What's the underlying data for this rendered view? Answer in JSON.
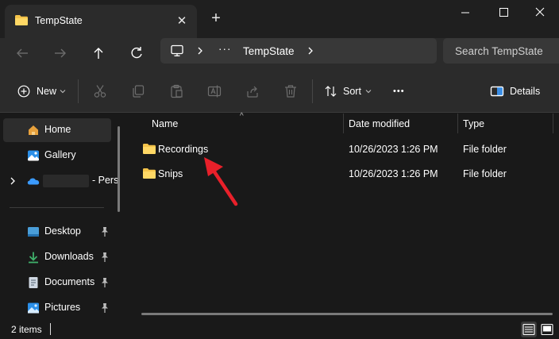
{
  "window": {
    "tab_title": "TempState",
    "tab_close_glyph": "✕",
    "new_tab_glyph": "+",
    "controls": [
      "minimize-icon",
      "maximize-icon",
      "close-icon"
    ]
  },
  "address": {
    "more_glyph": "···",
    "crumbs": [
      "TempState"
    ],
    "search_placeholder": "Search TempState"
  },
  "toolbar": {
    "new_label": "New",
    "sort_label": "Sort",
    "more_glyph": "•••",
    "details_label": "Details",
    "icons": [
      "cut-icon",
      "copy-icon",
      "paste-icon",
      "rename-icon",
      "share-icon",
      "delete-icon"
    ]
  },
  "sidebar": {
    "items": [
      {
        "label": "Home",
        "icon": "home-icon",
        "pinned": false
      },
      {
        "label": "Gallery",
        "icon": "gallery-icon",
        "pinned": false
      },
      {
        "label": "- Pers",
        "icon": "onedrive-icon",
        "pinned": false
      },
      {
        "label": "Desktop",
        "icon": "desktop-icon",
        "pinned": true
      },
      {
        "label": "Downloads",
        "icon": "downloads-icon",
        "pinned": true
      },
      {
        "label": "Documents",
        "icon": "documents-icon",
        "pinned": true
      },
      {
        "label": "Pictures",
        "icon": "pictures-icon",
        "pinned": true
      }
    ]
  },
  "content": {
    "columns": [
      "Name",
      "Date modified",
      "Type"
    ],
    "rows": [
      {
        "name": "Recordings",
        "date": "10/26/2023 1:26 PM",
        "type": "File folder"
      },
      {
        "name": "Snips",
        "date": "10/26/2023 1:26 PM",
        "type": "File folder"
      }
    ]
  },
  "status": {
    "item_count": "2 items"
  },
  "colors": {
    "accent_arrow": "#e8202a",
    "folder_yellow": "#f4c34a",
    "onedrive_blue": "#3b9bff"
  }
}
